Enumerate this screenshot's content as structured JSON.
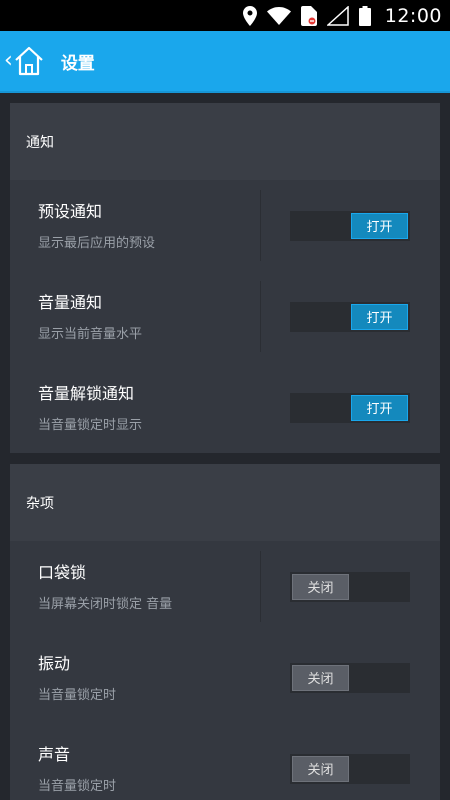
{
  "status_bar": {
    "time": "12:00",
    "icons": [
      "location-icon",
      "wifi-icon",
      "sim-icon",
      "signal-icon",
      "battery-icon"
    ]
  },
  "action_bar": {
    "back_glyph": "‹",
    "title": "设置"
  },
  "sections": [
    {
      "header": "通知",
      "rows": [
        {
          "title": "预设通知",
          "subtitle": "显示最后应用的预设",
          "toggle_label": "打开",
          "state": "on"
        },
        {
          "title": "音量通知",
          "subtitle": "显示当前音量水平",
          "toggle_label": "打开",
          "state": "on"
        },
        {
          "title": "音量解锁通知",
          "subtitle": "当音量锁定时显示",
          "toggle_label": "打开",
          "state": "on"
        }
      ]
    },
    {
      "header": "杂项",
      "rows": [
        {
          "title": "口袋锁",
          "subtitle": "当屏幕关闭时锁定 音量",
          "toggle_label": "关闭",
          "state": "off"
        },
        {
          "title": "振动",
          "subtitle": "当音量锁定时",
          "toggle_label": "关闭",
          "state": "off"
        },
        {
          "title": "声音",
          "subtitle": "当音量锁定时",
          "toggle_label": "关闭",
          "state": "off"
        }
      ]
    }
  ],
  "colors": {
    "accent": "#1aa7ec",
    "toggle_on": "#1489bd",
    "toggle_off": "#5a5e66",
    "background": "#24272d",
    "card": "#343840"
  }
}
